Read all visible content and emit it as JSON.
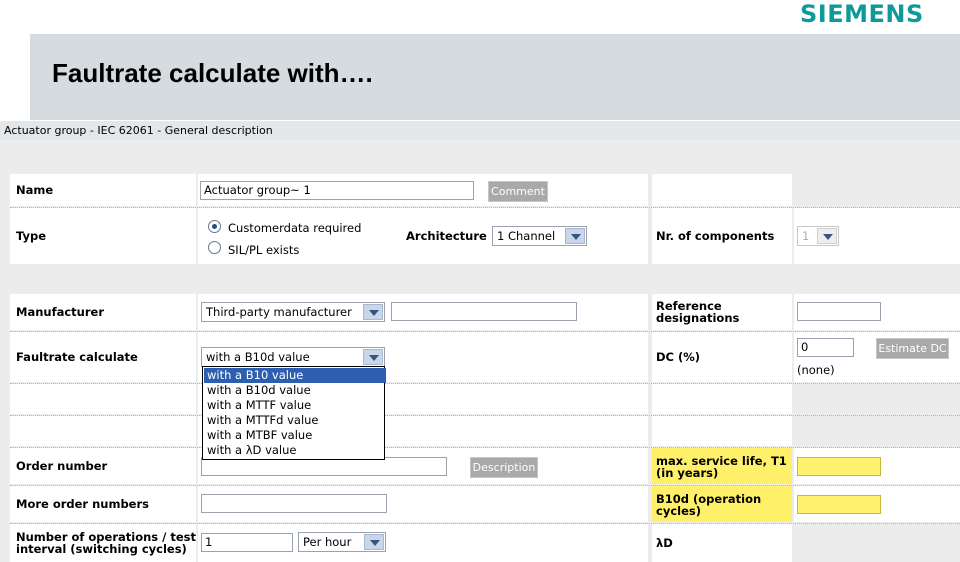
{
  "brand": {
    "logo_text": "SIEMENS",
    "logo_color": "#0f9a9a"
  },
  "slide": {
    "title": "Faultrate calculate with…."
  },
  "window": {
    "title": "Actuator group - IEC 62061 - General description"
  },
  "form": {
    "name_label": "Name",
    "name_value": "Actuator group~ 1",
    "comment_button": "Comment",
    "type_label": "Type",
    "type_options": [
      {
        "label": "Customerdata required",
        "selected": true
      },
      {
        "label": "SIL/PL exists",
        "selected": false
      }
    ],
    "architecture_label": "Architecture",
    "architecture_value": "1 Channel",
    "nr_components_label": "Nr. of components",
    "nr_components_value": "1",
    "manufacturer_label": "Manufacturer",
    "manufacturer_value": "Third-party manufacturer",
    "manufacturer_text": "",
    "reference_label_line1": "Reference",
    "reference_label_line2": "designations",
    "reference_value": "",
    "faultrate_label": "Faultrate calculate",
    "faultrate_value": "with a B10d value",
    "faultrate_options": [
      "with a B10 value",
      "with a B10d value",
      "with a MTTF value",
      "with a MTTFd value",
      "with a MTBF value",
      "with a λD value"
    ],
    "faultrate_highlighted": "with a B10 value",
    "dc_label": "DC (%)",
    "dc_value": "0",
    "dc_note": "(none)",
    "estimate_dc_button": "Estimate DC",
    "order_number_label": "Order number",
    "order_number_value": "",
    "description_button": "Description",
    "service_life_label_line1": "max. service life, T1",
    "service_life_label_line2": "(in years)",
    "service_life_value": "",
    "more_order_label": "More order numbers",
    "more_order_value": "",
    "b10d_label_line1": "B10d (operation",
    "b10d_label_line2": "cycles)",
    "b10d_value": "",
    "operations_label_line1": "Number of operations / test",
    "operations_label_line2": "interval (switching cycles)",
    "operations_value": "1",
    "operations_unit": "Per hour",
    "lambda_label": "λD"
  },
  "colors": {
    "highlight": "#fff06a",
    "selection": "#2d5fb0",
    "title_bar": "#d6dbe0"
  }
}
